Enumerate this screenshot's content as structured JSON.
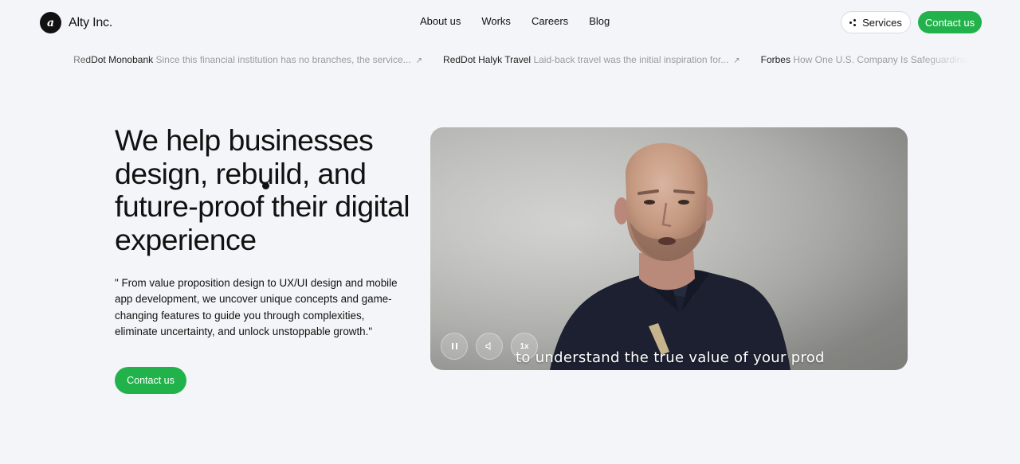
{
  "brand": {
    "name": "Alty Inc.",
    "logo_letter": "a"
  },
  "nav": [
    {
      "label": "About us"
    },
    {
      "label": "Works"
    },
    {
      "label": "Careers"
    },
    {
      "label": "Blog"
    }
  ],
  "header_actions": {
    "services_label": "Services",
    "contact_label": "Contact us"
  },
  "ticker": [
    {
      "source": "RedDot Monobank",
      "text": "Since this financial institution has no branches, the service...",
      "icon": "arrow-up-right-icon"
    },
    {
      "source": "RedDot Halyk Travel",
      "text": "Laid-back travel was the initial inspiration for...",
      "icon": "arrow-up-right-icon"
    },
    {
      "source": "Forbes",
      "text": "How One U.S. Company Is Safeguarding Tech",
      "icon": "arrow-up-right-icon"
    }
  ],
  "hero": {
    "title": "We help businesses design, rebuild, and future-proof their digital experience",
    "description": "\" From value proposition design to UX/UI design and mobile app development, we uncover unique concepts and game-changing features to guide you through complexities, eliminate uncertainty, and unlock unstoppable growth.\"",
    "cta_label": "Contact us"
  },
  "video": {
    "caption": "to understand the true value of your product?",
    "speed_label": "1x"
  },
  "colors": {
    "accent": "#22b24c",
    "background": "#f4f5f8",
    "text": "#111111"
  }
}
